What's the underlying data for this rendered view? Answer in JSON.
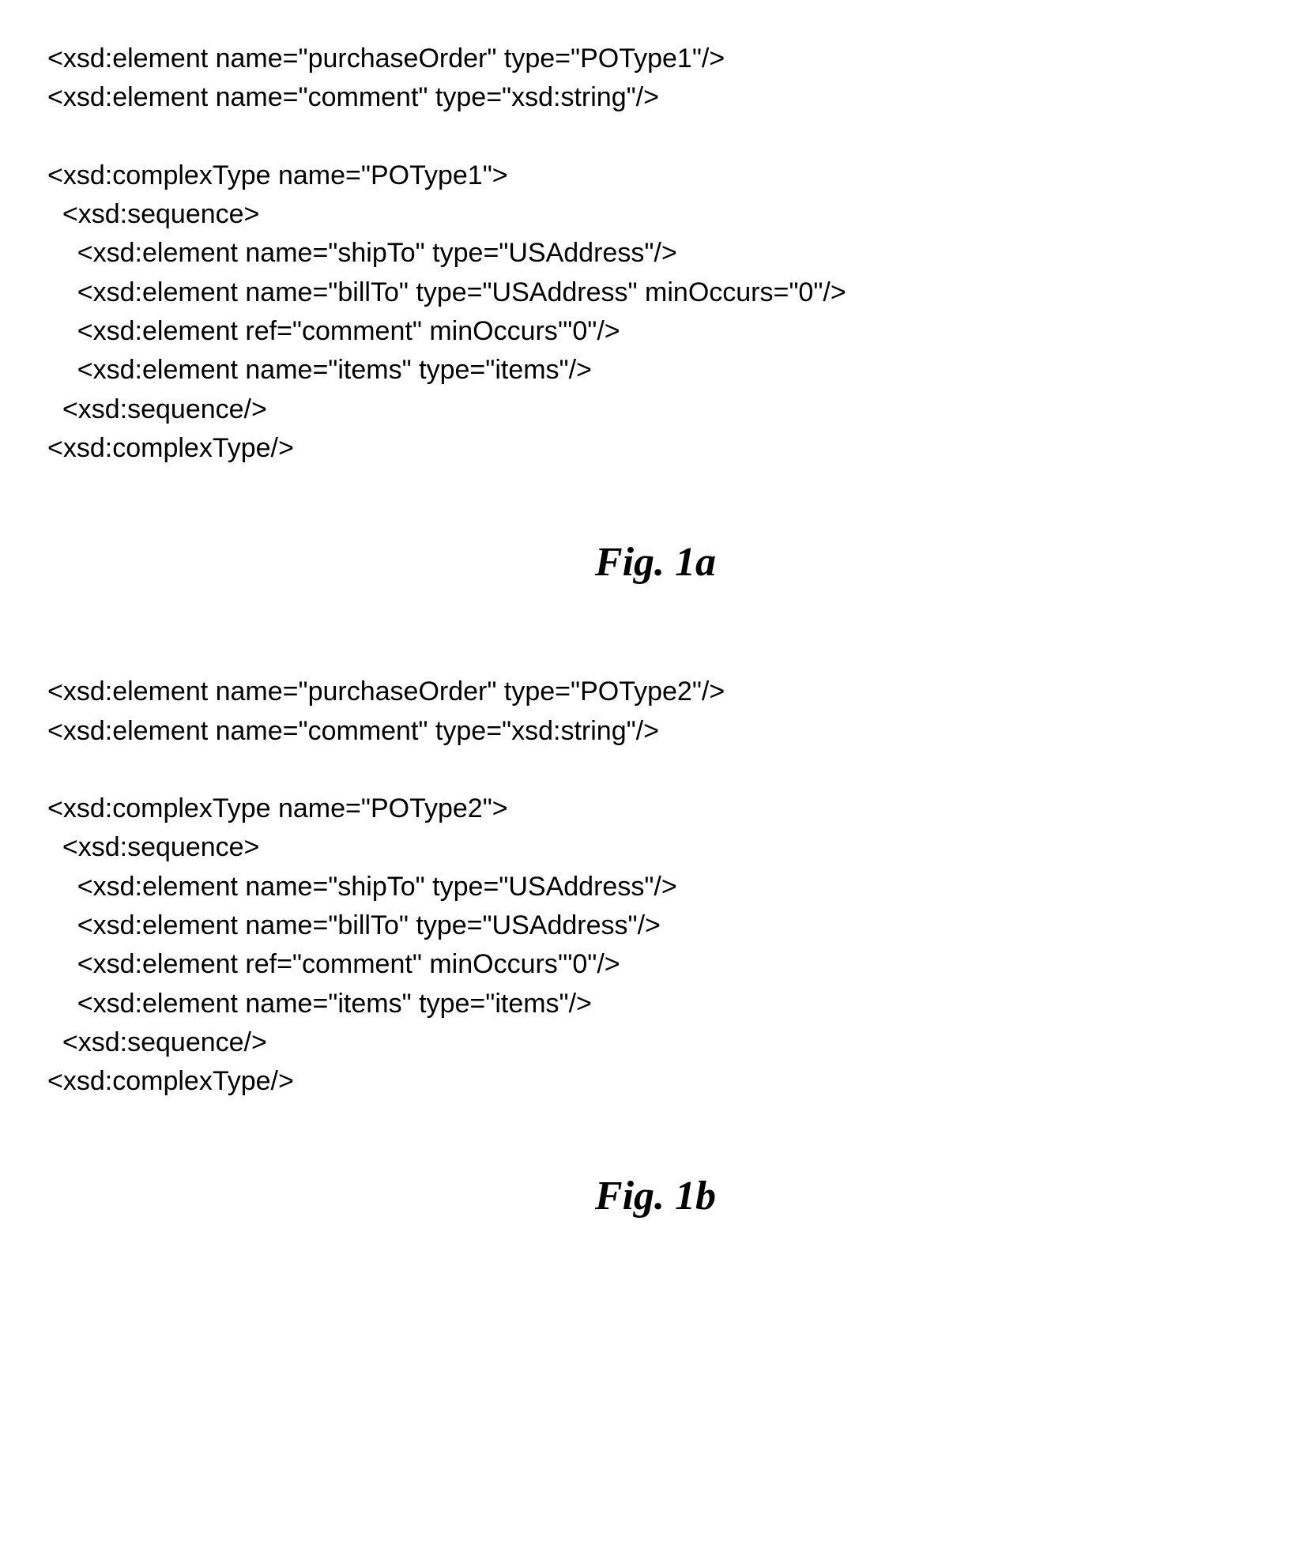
{
  "figA": {
    "lines": [
      "<xsd:element name=\"purchaseOrder\" type=\"POType1\"/>",
      "<xsd:element name=\"comment\" type=\"xsd:string\"/>",
      "",
      "<xsd:complexType name=\"POType1\">",
      "  <xsd:sequence>",
      "    <xsd:element name=\"shipTo\" type=\"USAddress\"/>",
      "    <xsd:element name=\"billTo\" type=\"USAddress\" minOccurs=\"0\"/>",
      "    <xsd:element ref=\"comment\" minOccurs'\"0\"/>",
      "    <xsd:element name=\"items\" type=\"items\"/>",
      "  <xsd:sequence/>",
      "<xsd:complexType/>"
    ],
    "caption": "Fig. 1a"
  },
  "figB": {
    "lines": [
      "<xsd:element name=\"purchaseOrder\" type=\"POType2\"/>",
      "<xsd:element name=\"comment\" type=\"xsd:string\"/>",
      "",
      "<xsd:complexType name=\"POType2\">",
      "  <xsd:sequence>",
      "    <xsd:element name=\"shipTo\" type=\"USAddress\"/>",
      "    <xsd:element name=\"billTo\" type=\"USAddress\"/>",
      "    <xsd:element ref=\"comment\" minOccurs'\"0\"/>",
      "    <xsd:element name=\"items\" type=\"items\"/>",
      "  <xsd:sequence/>",
      "<xsd:complexType/>"
    ],
    "caption": "Fig. 1b"
  }
}
